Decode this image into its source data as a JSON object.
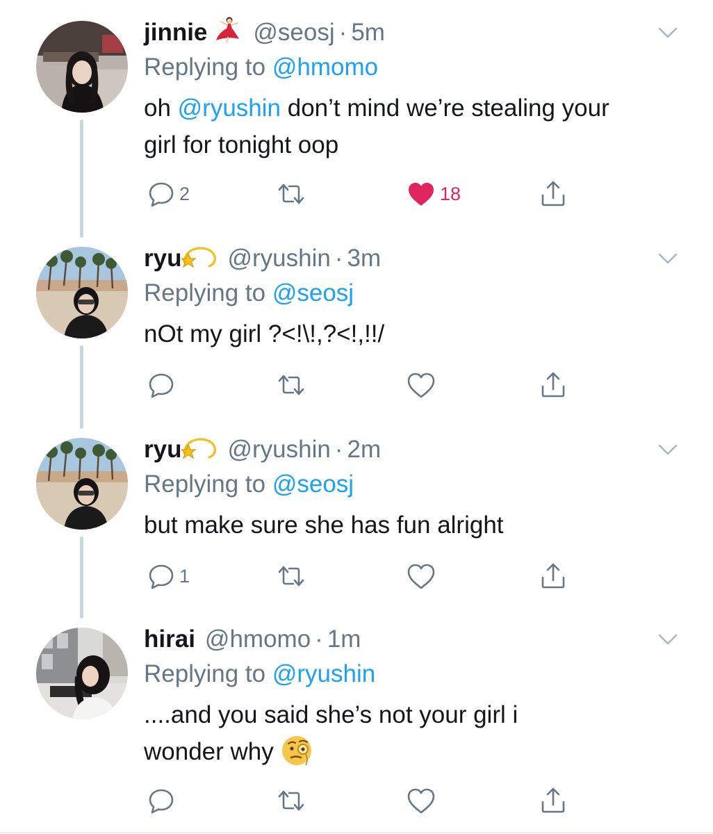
{
  "colors": {
    "link": "#1da1f2",
    "muted": "#657786",
    "like": "#e0245e",
    "text": "#14171a",
    "thread": "#ccd6dd"
  },
  "tweets": [
    {
      "name": "jinnie",
      "name_emoji": "dancer-emoji",
      "handle": "@seosj",
      "separator": "·",
      "time": "5m",
      "replying_prefix": "Replying to",
      "replying_to": "@hmomo",
      "body_pre": "oh ",
      "body_mention": "@ryushin",
      "body_post": " don’t mind we’re stealing your girl for tonight oop",
      "reply_count": "2",
      "retweet_count": "",
      "like_count": "18",
      "liked": true
    },
    {
      "name": "ryu",
      "name_emoji": "dizzy-emoji",
      "handle": "@ryushin",
      "separator": "·",
      "time": "3m",
      "replying_prefix": "Replying to",
      "replying_to": "@seosj",
      "body": "nOt my girl ?<!\\!,?<!,!!/",
      "reply_count": "",
      "like_count": "",
      "liked": false
    },
    {
      "name": "ryu",
      "name_emoji": "dizzy-emoji",
      "handle": "@ryushin",
      "separator": "·",
      "time": "2m",
      "replying_prefix": "Replying to",
      "replying_to": "@seosj",
      "body": "but make sure she has fun alright",
      "reply_count": "1",
      "like_count": "",
      "liked": false
    },
    {
      "name": "hirai",
      "handle": "@hmomo",
      "separator": "·",
      "time": "1m",
      "replying_prefix": "Replying to",
      "replying_to": "@ryushin",
      "body": "....and you said she’s not your girl i wonder why",
      "body_emoji": "face-with-monocle-emoji",
      "reply_count": "",
      "like_count": "",
      "liked": false
    }
  ]
}
